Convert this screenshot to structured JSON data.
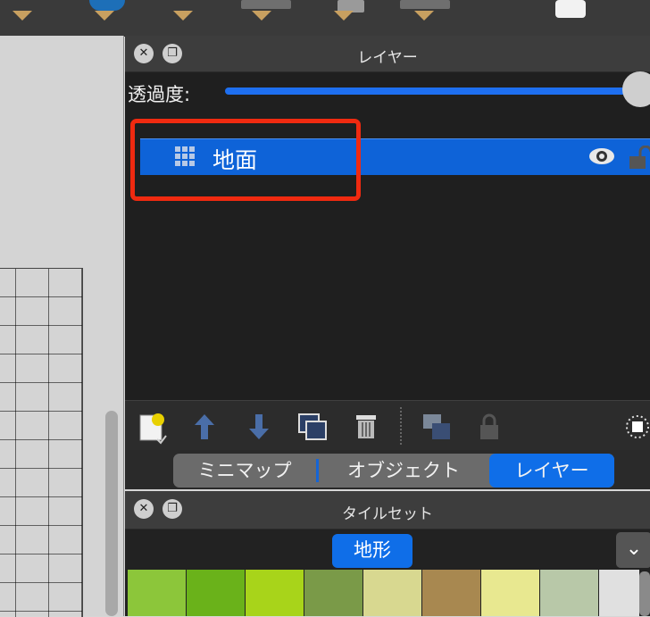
{
  "layer_panel": {
    "title": "レイヤー",
    "opacity_label": "透過度:",
    "opacity_value": 1.0,
    "layers": [
      {
        "name": "地面",
        "visible": true,
        "locked": false,
        "selected": true
      }
    ]
  },
  "tabs": {
    "items": [
      "ミニマップ",
      "オブジェクト",
      "レイヤー"
    ],
    "active": "レイヤー"
  },
  "tileset_panel": {
    "title": "タイルセット",
    "active_tileset": "地形",
    "dropdown_icon": "chevron-down-icon",
    "tile_colors": [
      "#8cc63a",
      "#6ab21a",
      "#a8d41a",
      "#7a9a48",
      "#d8d890",
      "#a88850",
      "#e8e890",
      "#b8c8a8",
      "#e0e0e0"
    ]
  },
  "colors": {
    "selection": "#0e63d8",
    "highlight_box": "#f02a10",
    "accent": "#0f6ee8"
  }
}
